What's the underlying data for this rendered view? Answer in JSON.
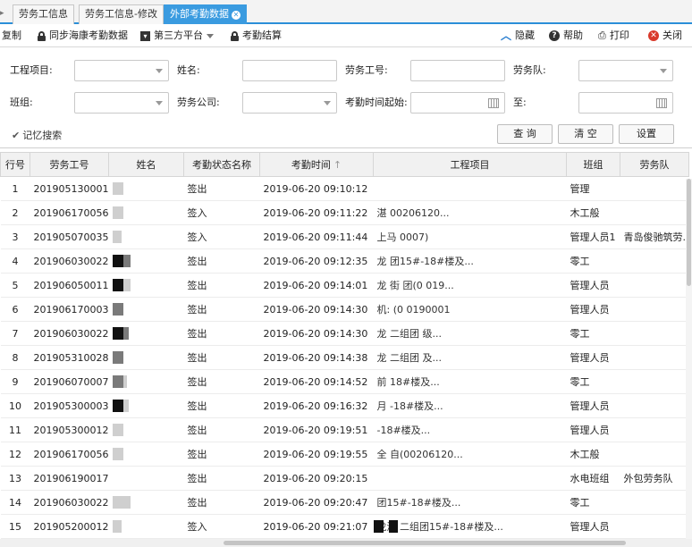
{
  "tabs": [
    {
      "label": "劳务工信息",
      "active": false
    },
    {
      "label": "劳务工信息-修改",
      "active": false
    },
    {
      "label": "外部考勤数据",
      "active": true
    }
  ],
  "toolbar": {
    "copy": "复制",
    "sync": "同步海康考勤数据",
    "third_party": "第三方平台",
    "settle": "考勤结算",
    "hide": "隐藏",
    "help": "帮助",
    "print": "打印",
    "close": "关闭"
  },
  "form": {
    "project_label": "工程项目:",
    "name_label": "姓名:",
    "worker_no_label": "劳务工号:",
    "team_label": "劳务队:",
    "group_label": "班组:",
    "company_label": "劳务公司:",
    "time_from_label": "考勤时间起始:",
    "time_to_label": "至:",
    "remember_label": "记忆搜索",
    "query_btn": "查 询",
    "clear_btn": "清 空",
    "settings_btn": "设置"
  },
  "table": {
    "headers": [
      "行号",
      "劳务工号",
      "姓名",
      "考勤状态名称",
      "考勤时间",
      "工程项目",
      "班组",
      "劳务队"
    ],
    "rows": [
      {
        "n": "1",
        "id": "201905130001",
        "status": "签出",
        "time": "2019-06-20 09:10:12",
        "proj": "",
        "group": "管理",
        "team": ""
      },
      {
        "n": "2",
        "id": "201906170056",
        "status": "签入",
        "time": "2019-06-20 09:11:22",
        "proj": "湛                    00206120...",
        "group": "木工般",
        "team": ""
      },
      {
        "n": "3",
        "id": "201905070035",
        "status": "签入",
        "time": "2019-06-20 09:11:44",
        "proj": "上马                          0007)",
        "group": "管理人员1",
        "team": "青岛俊驰筑劳..."
      },
      {
        "n": "4",
        "id": "201906030022",
        "status": "签出",
        "time": "2019-06-20 09:12:35",
        "proj": "龙                  团15#-18#楼及...",
        "group": "零工",
        "team": ""
      },
      {
        "n": "5",
        "id": "201906050011",
        "status": "签出",
        "time": "2019-06-20 09:14:01",
        "proj": "龙         街        团(0          019...",
        "group": "管理人员",
        "team": ""
      },
      {
        "n": "6",
        "id": "201906170003",
        "status": "签出",
        "time": "2019-06-20 09:14:30",
        "proj": "机:          (0        0190001",
        "group": "管理人员",
        "team": ""
      },
      {
        "n": "7",
        "id": "201906030022",
        "status": "签出",
        "time": "2019-06-20 09:14:30",
        "proj": "龙                 二组团          级...",
        "group": "零工",
        "team": ""
      },
      {
        "n": "8",
        "id": "201905310028",
        "status": "签出",
        "time": "2019-06-20 09:14:38",
        "proj": "龙                 二组团          及...",
        "group": "管理人员",
        "team": ""
      },
      {
        "n": "9",
        "id": "201906070007",
        "status": "签出",
        "time": "2019-06-20 09:14:52",
        "proj": "                   前         18#楼及...",
        "group": "零工",
        "team": ""
      },
      {
        "n": "10",
        "id": "201905300003",
        "status": "签出",
        "time": "2019-06-20 09:16:32",
        "proj": "                   月     -18#楼及...",
        "group": "管理人员",
        "team": ""
      },
      {
        "n": "11",
        "id": "201905300012",
        "status": "签出",
        "time": "2019-06-20 09:19:51",
        "proj": "                          -18#楼及...",
        "group": "管理人员",
        "team": ""
      },
      {
        "n": "12",
        "id": "201906170056",
        "status": "签出",
        "time": "2019-06-20 09:19:55",
        "proj": "         全              自(00206120...",
        "group": "木工般",
        "team": ""
      },
      {
        "n": "13",
        "id": "201906190017",
        "status": "签出",
        "time": "2019-06-20 09:20:15",
        "proj": "",
        "group": "水电班组",
        "team": "外包劳务队"
      },
      {
        "n": "14",
        "id": "201906030022",
        "status": "签出",
        "time": "2019-06-20 09:20:47",
        "proj": "                 团15#-18#楼及...",
        "group": "零工",
        "team": ""
      },
      {
        "n": "15",
        "id": "201905200012",
        "status": "签入",
        "time": "2019-06-20 09:21:07",
        "proj": "龙湖          二组团15#-18#楼及...",
        "group": "管理人员",
        "team": ""
      }
    ]
  }
}
